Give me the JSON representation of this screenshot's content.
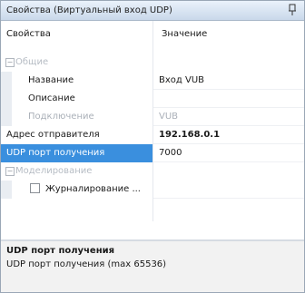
{
  "panel": {
    "title": "Свойства (Виртуальный вход UDP)",
    "pin_glyph": "ᵽ"
  },
  "columns": {
    "property": "Свойства",
    "value": "Значение"
  },
  "rows": [
    {
      "type": "group",
      "label": "Общие"
    },
    {
      "type": "prop",
      "label": "Название",
      "value": "Вход VUB"
    },
    {
      "type": "prop",
      "label": "Описание",
      "value": ""
    },
    {
      "type": "prop",
      "label": "Подключение",
      "value": "VUB"
    },
    {
      "type": "prop",
      "label": "Адрес отправителя",
      "value": "192.168.0.1"
    },
    {
      "type": "prop",
      "label": "UDP порт получения",
      "value": "7000"
    },
    {
      "type": "group",
      "label": "Моделирование"
    },
    {
      "type": "check",
      "label": "Журналирование ..."
    }
  ],
  "help": {
    "title": "UDP порт получения",
    "description": "UDP порт получения (max 65536)"
  }
}
